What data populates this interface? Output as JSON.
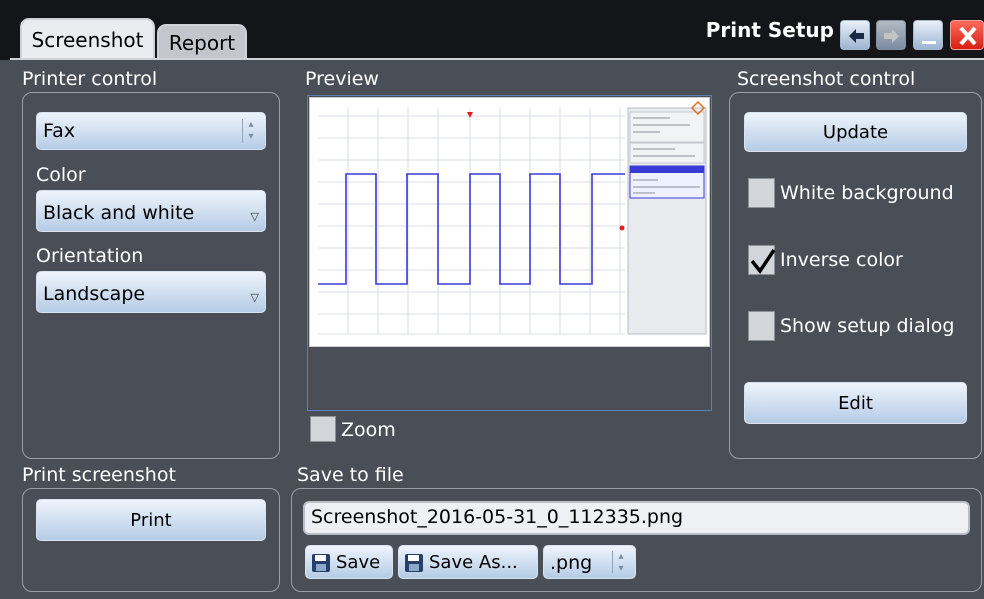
{
  "window": {
    "title": "Print Setup",
    "tabs": [
      {
        "label": "Screenshot",
        "active": true
      },
      {
        "label": "Report",
        "active": false
      }
    ]
  },
  "icons": {
    "back": "back-arrow-icon",
    "forward": "forward-arrow-icon",
    "minimize": "minimize-icon",
    "close": "close-icon"
  },
  "colors": {
    "accent_button": "#b5cce6",
    "close": "#e23b2e",
    "waveform": "#3a3ad6",
    "trigger_marker": "#e02020"
  },
  "printer_control": {
    "title": "Printer control",
    "printer": "Fax",
    "color_label": "Color",
    "color_value": "Black and white",
    "orientation_label": "Orientation",
    "orientation_value": "Landscape"
  },
  "preview": {
    "title": "Preview",
    "zoom_label": "Zoom",
    "zoom_checked": false
  },
  "screenshot_control": {
    "title": "Screenshot control",
    "update_label": "Update",
    "white_background_label": "White background",
    "white_background_checked": false,
    "inverse_color_label": "Inverse color",
    "inverse_color_checked": true,
    "show_setup_dialog_label": "Show setup dialog",
    "show_setup_dialog_checked": false,
    "edit_label": "Edit"
  },
  "print_screenshot": {
    "title": "Print screenshot",
    "print_label": "Print"
  },
  "save_to_file": {
    "title": "Save to file",
    "filename": "Screenshot_2016-05-31_0_112335.png",
    "save_label": "Save",
    "save_as_label": "Save As...",
    "format": ".png"
  }
}
